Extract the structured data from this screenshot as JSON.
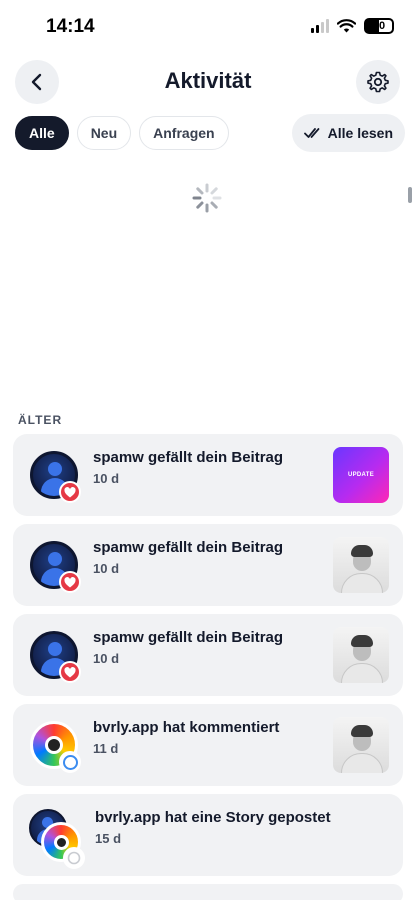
{
  "status_bar": {
    "time": "14:14",
    "battery": "50"
  },
  "header": {
    "title": "Aktivität"
  },
  "tabs": [
    {
      "label": "Alle",
      "active": true
    },
    {
      "label": "Neu",
      "active": false
    },
    {
      "label": "Anfragen",
      "active": false
    }
  ],
  "read_all_label": "Alle lesen",
  "section_label": "ÄLTER",
  "notifications": [
    {
      "title": "spamw gefällt dein Beitrag",
      "time": "10 d",
      "type": "like",
      "thumb": "update",
      "thumb_text": "UPDATE"
    },
    {
      "title": "spamw gefällt dein Beitrag",
      "time": "10 d",
      "type": "like",
      "thumb": "photo"
    },
    {
      "title": "spamw gefällt dein Beitrag",
      "time": "10 d",
      "type": "like",
      "thumb": "photo"
    },
    {
      "title": "bvrly.app hat kommentiert",
      "time": "11 d",
      "type": "comment",
      "thumb": "photo"
    },
    {
      "title": "bvrly.app hat eine Story gepostet",
      "time": "15 d",
      "type": "story"
    }
  ],
  "colors": {
    "accent": "#141a2b",
    "like": "#e53945",
    "comment": "#3b8cf0",
    "card_bg": "#f1f2f4"
  }
}
